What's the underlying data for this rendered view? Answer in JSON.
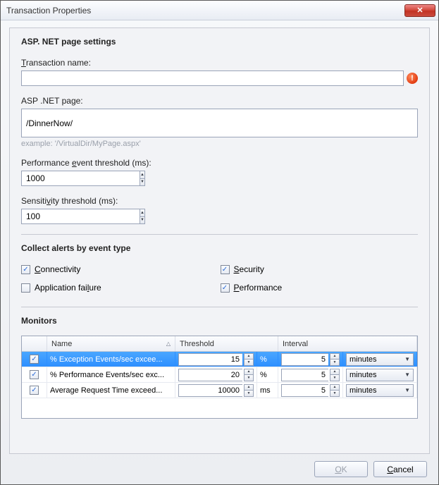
{
  "window": {
    "title": "Transaction Properties",
    "close_glyph": "✕"
  },
  "section_page_settings": "ASP. NET page settings",
  "transaction_name": {
    "label_pre": "",
    "label_u": "T",
    "label_post": "ransaction name:",
    "value": "",
    "error_glyph": "!"
  },
  "asp_page": {
    "label_pre": "ASP .NET pa",
    "label_u": "g",
    "label_post": "e:",
    "value": "/DinnerNow/",
    "example": "example: '/VirtualDir/MyPage.aspx'"
  },
  "perf_threshold": {
    "label_pre": "Performance ",
    "label_u": "e",
    "label_post": "vent threshold (ms):",
    "value": "1000"
  },
  "sens_threshold": {
    "label_pre": "Sensiti",
    "label_u": "v",
    "label_post": "ity threshold (ms):",
    "value": "100"
  },
  "section_collect": "Collect alerts by event type",
  "checks": {
    "connectivity": {
      "label_u": "C",
      "label_post": "onnectivity",
      "checked": true
    },
    "security": {
      "label_u": "S",
      "label_post": "ecurity",
      "checked": true
    },
    "app_failure": {
      "label_pre": "Application fai",
      "label_u": "l",
      "label_post": "ure",
      "checked": false
    },
    "performance": {
      "label_u": "P",
      "label_post": "erformance",
      "checked": true
    }
  },
  "section_monitors": "Monitors",
  "monitors_head": {
    "name": "Name",
    "threshold": "Threshold",
    "interval": "Interval"
  },
  "monitors": [
    {
      "checked": true,
      "name": "% Exception Events/sec excee...",
      "threshold": "15",
      "unit": "%",
      "interval": "5",
      "interval_unit": "minutes",
      "selected": true
    },
    {
      "checked": true,
      "name": "% Performance Events/sec exc...",
      "threshold": "20",
      "unit": "%",
      "interval": "5",
      "interval_unit": "minutes",
      "selected": false
    },
    {
      "checked": true,
      "name": "Average Request Time exceed...",
      "threshold": "10000",
      "unit": "ms",
      "interval": "5",
      "interval_unit": "minutes",
      "selected": false
    }
  ],
  "buttons": {
    "ok_u": "O",
    "ok_post": "K",
    "cancel_u": "C",
    "cancel_post": "ancel"
  }
}
